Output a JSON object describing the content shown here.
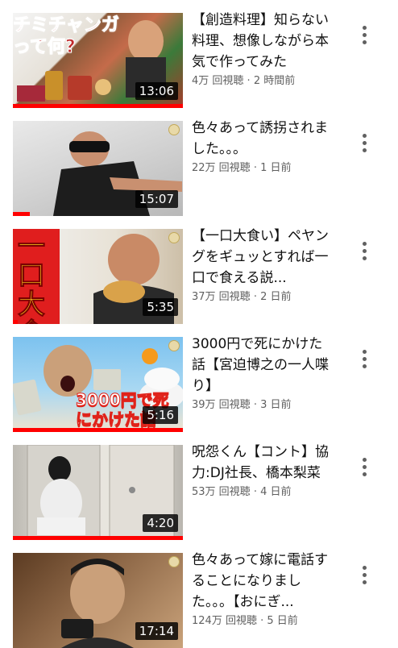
{
  "videos": [
    {
      "title": "【創造料理】知らない料理、想像しながら本気で作ってみた",
      "views": "4万 回視聴",
      "age": "2 時間前",
      "duration": "13:06",
      "progress": 1.0,
      "thumb_text": "チミチャンガって何?",
      "thumb_colors": [
        "#7a5a3a",
        "#c8a27a"
      ]
    },
    {
      "title": "色々あって誘拐されました。。。",
      "views": "22万 回視聴",
      "age": "1 日前",
      "duration": "15:07",
      "progress": 0.1,
      "thumb_text": "",
      "thumb_colors": [
        "#cfcfcf",
        "#9a9a9a"
      ]
    },
    {
      "title": "【一口大食い】ペヤングをギュッとすれば一口で食える説...",
      "views": "37万 回視聴",
      "age": "2 日前",
      "duration": "5:35",
      "progress": 0.03,
      "thumb_text": "一口大食",
      "thumb_colors": [
        "#d84c1a",
        "#f0b070"
      ]
    },
    {
      "title": "3000円で死にかけた話【宮迫博之の一人喋り】",
      "views": "39万 回視聴",
      "age": "3 日前",
      "duration": "5:16",
      "progress": 1.0,
      "thumb_text": "3000円で死にかけた話",
      "thumb_colors": [
        "#6fb6e8",
        "#e8d8c0"
      ]
    },
    {
      "title": "呪怨くん【コント】協力:DJ社長、橋本梨菜",
      "views": "53万 回視聴",
      "age": "4 日前",
      "duration": "4:20",
      "progress": 1.0,
      "thumb_text": "",
      "thumb_colors": [
        "#d9d6d0",
        "#8d8a84"
      ]
    },
    {
      "title": "色々あって嫁に電話することになりました。。。【おにぎ...",
      "views": "124万 回視聴",
      "age": "5 日前",
      "duration": "17:14",
      "progress": 0.0,
      "thumb_text": "",
      "thumb_colors": [
        "#6b4a2e",
        "#caa47a"
      ]
    }
  ],
  "accent": "#ff0000",
  "separator": " · "
}
